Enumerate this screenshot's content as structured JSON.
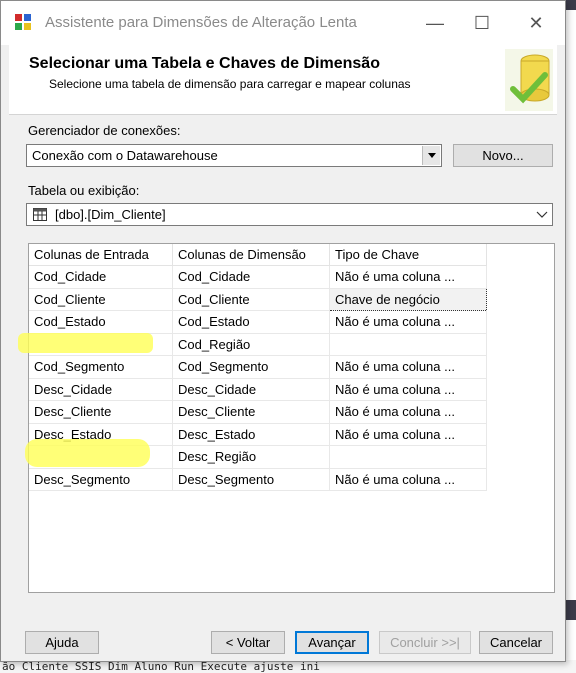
{
  "window": {
    "title": "Assistente para Dimensões de Alteração Lenta",
    "minimize_glyph": "—",
    "maximize_glyph": "☐",
    "close_glyph": "✕"
  },
  "header": {
    "title": "Selecionar uma Tabela e Chaves de Dimensão",
    "subtitle": "Selecione uma tabela de dimensão para carregar e mapear colunas"
  },
  "connection": {
    "label": "Gerenciador de conexões:",
    "value": "Conexão com o Datawarehouse",
    "new_button": "Novo..."
  },
  "table": {
    "label": "Tabela ou exibição:",
    "value": "[dbo].[Dim_Cliente]"
  },
  "grid": {
    "headers": [
      "Colunas de Entrada",
      "Colunas de Dimensão",
      "Tipo de Chave"
    ],
    "rows": [
      [
        "Cod_Cidade",
        "Cod_Cidade",
        "Não é uma coluna ..."
      ],
      [
        "Cod_Cliente",
        "Cod_Cliente",
        "Chave de negócio"
      ],
      [
        "Cod_Estado",
        "Cod_Estado",
        "Não é uma coluna ..."
      ],
      [
        "",
        "Cod_Região",
        ""
      ],
      [
        "Cod_Segmento",
        "Cod_Segmento",
        "Não é uma coluna ..."
      ],
      [
        "Desc_Cidade",
        "Desc_Cidade",
        "Não é uma coluna ..."
      ],
      [
        "Desc_Cliente",
        "Desc_Cliente",
        "Não é uma coluna ..."
      ],
      [
        "Desc_Estado",
        "Desc_Estado",
        "Não é uma coluna ..."
      ],
      [
        "",
        "Desc_Região",
        ""
      ],
      [
        "Desc_Segmento",
        "Desc_Segmento",
        "Não é uma coluna ..."
      ]
    ]
  },
  "footer": {
    "help": "Ajuda",
    "back": "< Voltar",
    "next": "Avançar",
    "finish": "Concluir >>|",
    "cancel": "Cancelar"
  },
  "background": {
    "bottom_text": "ão Cliente SSIS Dim Aluno Run Execute ajuste ini"
  }
}
